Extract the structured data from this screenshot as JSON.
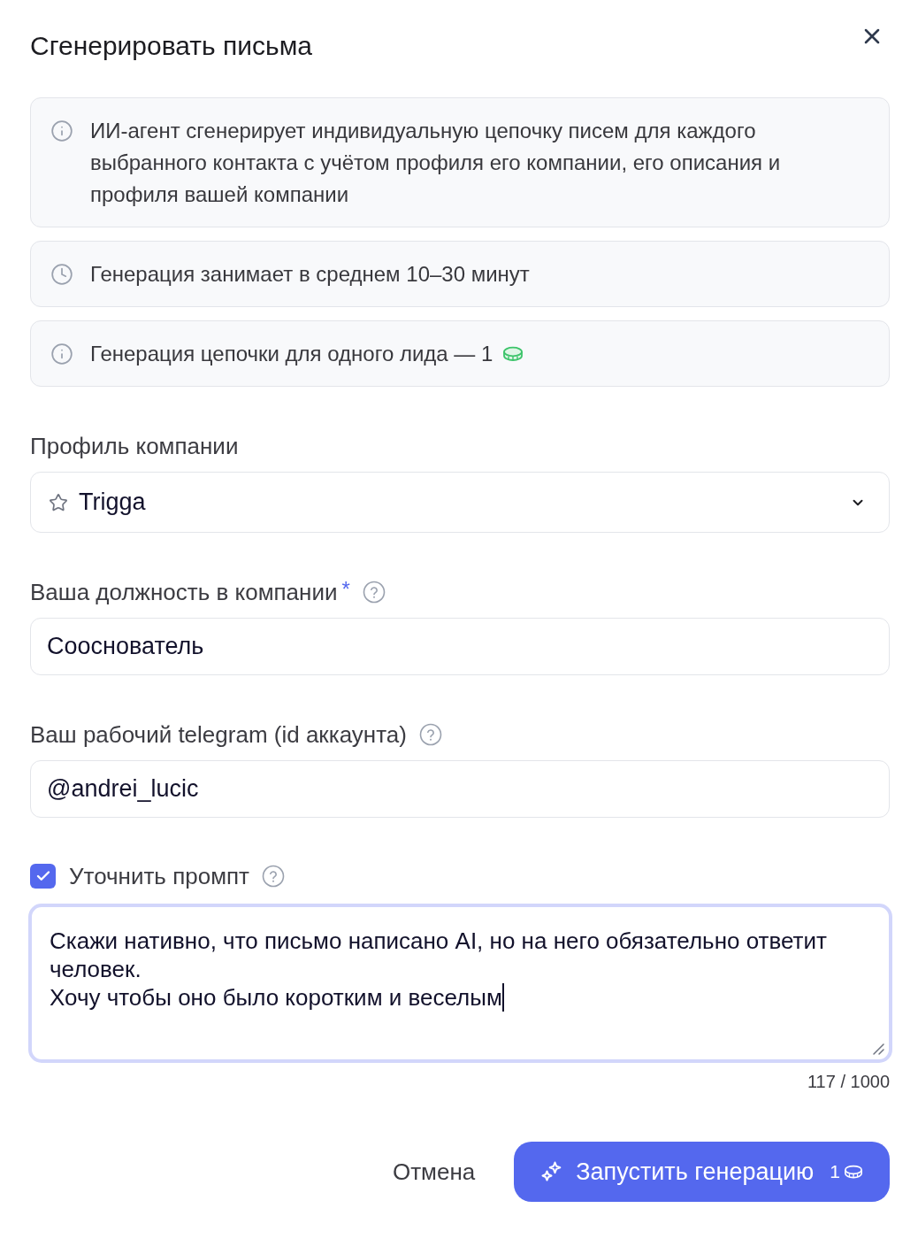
{
  "dialog": {
    "title": "Сгенерировать письма"
  },
  "notices": [
    {
      "kind": "info",
      "text": "ИИ-агент сгенерирует индивидуальную цепочку писем для каждого выбранного контакта с учётом профиля его компании, его описания и профиля вашей компании",
      "coin": false
    },
    {
      "kind": "time",
      "text": "Генерация занимает в среднем 10–30 минут",
      "coin": false
    },
    {
      "kind": "info",
      "text": "Генерация цепочки для одного лида — 1",
      "coin": true
    }
  ],
  "company_profile": {
    "label": "Профиль компании",
    "value": "Trigga"
  },
  "fields": [
    {
      "label": "Ваша должность в компании",
      "required_mark": "*",
      "help": true,
      "value": "Сооснователь"
    },
    {
      "label": "Ваш рабочий telegram (id аккаунта)",
      "help": true,
      "value": "@andrei_lucic"
    }
  ],
  "prompt": {
    "label": "Уточнить промпт",
    "checked": true,
    "help": true,
    "focused": true,
    "value": "Скажи нативно, что письмо написано AI, но на него обязательно ответит человек.\nХочу чтобы оно было коротким и веселым",
    "counter": "117 / 1000"
  },
  "buttons": {
    "cancel": "Отмена",
    "start": {
      "label": "Запустить генерацию",
      "cost": "1"
    }
  }
}
